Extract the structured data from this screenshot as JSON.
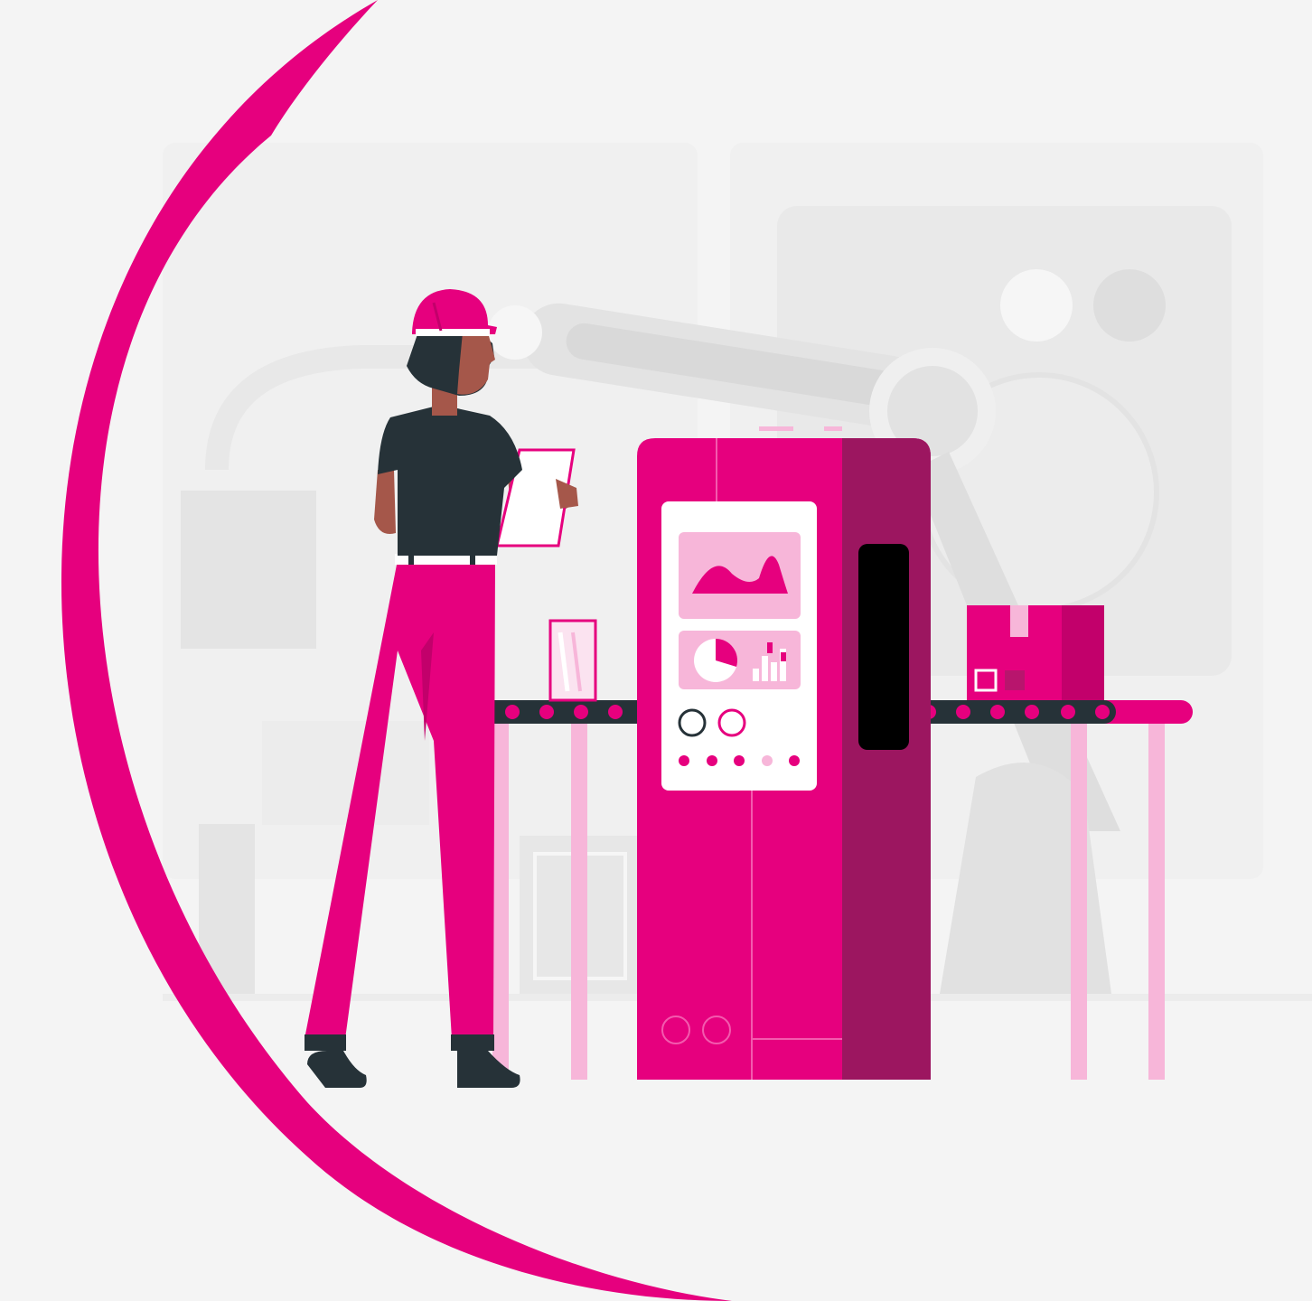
{
  "illustration": {
    "subject": "factory-worker-operating-machine",
    "colors": {
      "background": "#f4f4f4",
      "accent": "#e6007e",
      "accent_dark": "#9c1660",
      "accent_light": "#f7b6d9",
      "skin": "#a5574a",
      "hair": "#263238",
      "shirt": "#263238",
      "panel": "#ffffff"
    },
    "icons": [
      "arc-decoration",
      "robot-arm-icon",
      "worker-figure",
      "hard-hat-icon",
      "tablet-icon",
      "control-machine",
      "area-chart-icon",
      "pie-chart-icon",
      "bar-chart-icon",
      "conveyor-belt",
      "package-box-icon",
      "glass-jar-icon"
    ]
  }
}
